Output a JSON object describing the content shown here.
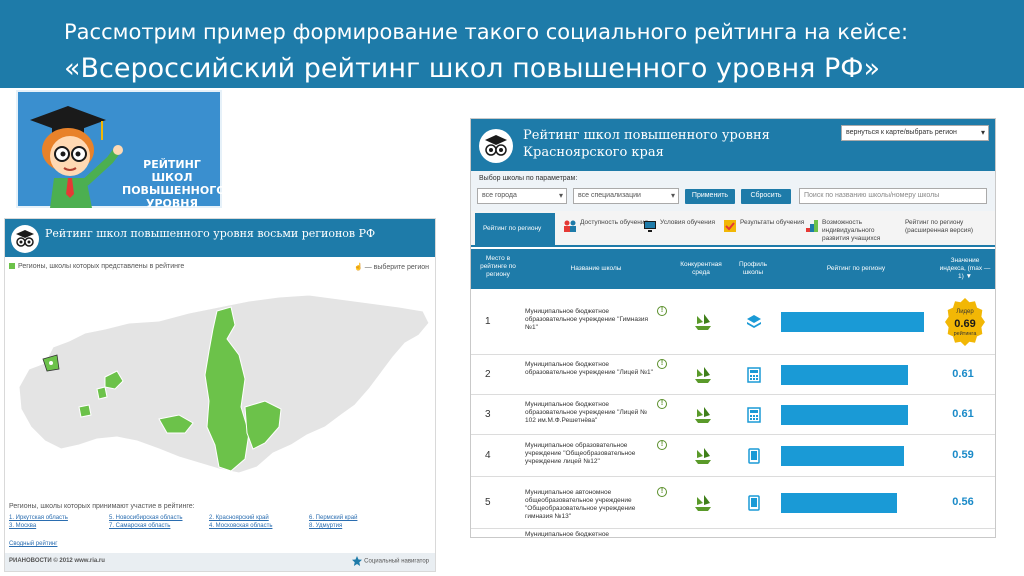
{
  "slide": {
    "line1": "Рассмотрим пример формирование такого социального рейтинга на кейсе:",
    "line2": "«Всероссийский рейтинг школ повышенного уровня РФ»"
  },
  "logo_banner": {
    "text": "РЕЙТИНГ ШКОЛ ПОВЫШЕННОГО УРОВНЯ"
  },
  "map_panel": {
    "title": "Рейтинг школ повышенного уровня восьми регионов РФ",
    "legend": "Регионы, школы которых представлены в рейтинге",
    "select_hint": "— выберите регион",
    "participants_title": "Регионы, школы которых принимают участие в рейтинге:",
    "participants": [
      "1. Иркутская область",
      "3. Москва",
      "5. Новосибирская область",
      "7. Самарская область",
      "2. Красноярский край",
      "4. Московская область",
      "6. Пермский край",
      "8. Удмуртия"
    ],
    "summary_link": "Сводный рейтинг",
    "footer_left": "РИАНОВОСТИ © 2012 www.ria.ru",
    "footer_right": "Социальный навигатор"
  },
  "rank_panel": {
    "title_line1": "Рейтинг школ повышенного уровня",
    "title_line2": "Красноярского края",
    "back_select": "вернуться к карте/выбрать регион",
    "filters": {
      "label": "Выбор школы по параметрам:",
      "city": "все города",
      "spec": "все специализации",
      "apply": "Применить",
      "reset": "Сбросить",
      "search_placeholder": "Поиск по названию школы/номеру школы"
    },
    "tabs": [
      "Рейтинг по региону",
      "Доступность обучения",
      "Условия обучения",
      "Результаты обучения",
      "Возможность индивидуального развития учащихся",
      "Рейтинг по региону (расширенная версия)"
    ],
    "columns": {
      "place": "Место в рейтинге по региону",
      "name": "Название школы",
      "env": "Конкурентная среда",
      "profile": "Профиль школы",
      "rating": "Рейтинг по региону",
      "index": "Значение индекса, (max — 1)"
    },
    "leader": {
      "label": "Лидер",
      "value": "0.69",
      "sub": "рейтинга"
    },
    "rows": [
      {
        "place": "1",
        "name": "Муниципальное бюджетное образовательное учреждение \"Гимназия №1\"",
        "score": "0.69",
        "value": 0.69
      },
      {
        "place": "2",
        "name": "Муниципальное бюджетное образовательное учреждение \"Лицей №1\"",
        "score": "0.61",
        "value": 0.61
      },
      {
        "place": "3",
        "name": "Муниципальное бюджетное образовательное учреждение \"Лицей № 102 им.М.Ф.Решетнёва\"",
        "score": "0.61",
        "value": 0.61
      },
      {
        "place": "4",
        "name": "Муниципальное образовательное учреждение \"Общеобразовательное учреждение лицей №12\"",
        "score": "0.59",
        "value": 0.59
      },
      {
        "place": "5",
        "name": "Муниципальное автономное общеобразовательное учреждение \"Общеобразовательное учреждение гимназия №13\"",
        "score": "0.56",
        "value": 0.56
      },
      {
        "place": "",
        "name": "Муниципальное бюджетное",
        "score": "",
        "value": 0
      }
    ]
  },
  "colors": {
    "brand_blue": "#1e7ba9",
    "bar_blue": "#1a9ad6",
    "map_green": "#6cc24a",
    "leader_gold": "#f2b705"
  }
}
